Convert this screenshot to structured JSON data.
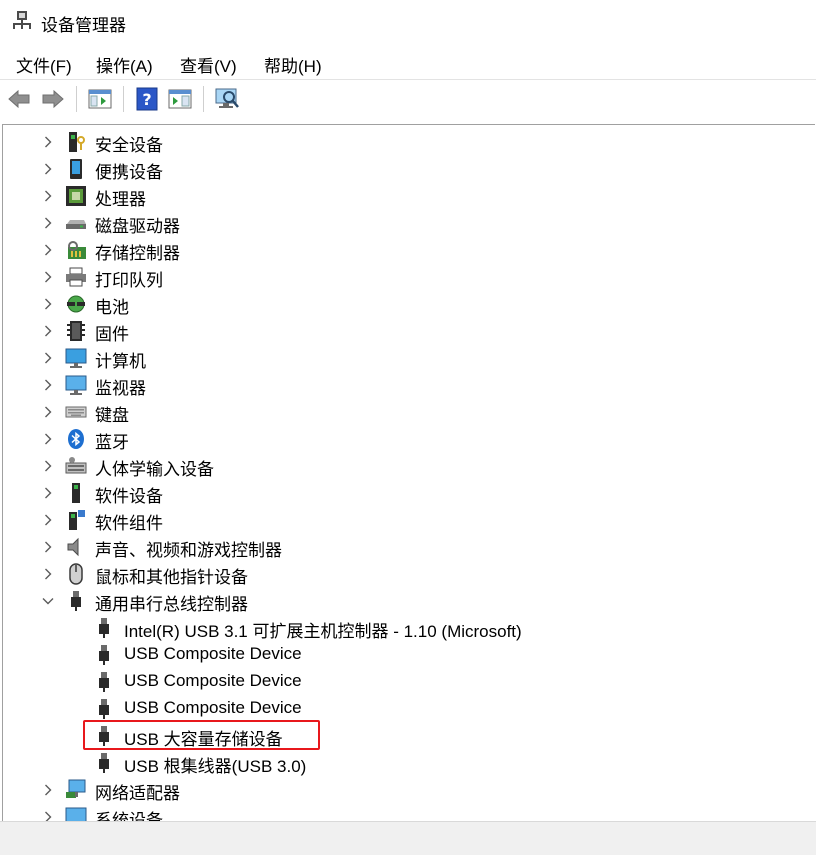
{
  "window": {
    "title": "设备管理器"
  },
  "menu": [
    {
      "label": "文件(F)"
    },
    {
      "label": "操作(A)"
    },
    {
      "label": "查看(V)"
    },
    {
      "label": "帮助(H)"
    }
  ],
  "toolbar": {
    "buttons": [
      {
        "name": "back-arrow-icon"
      },
      {
        "name": "forward-arrow-icon"
      },
      {
        "name": "show-hide-console-tree-icon"
      },
      {
        "name": "help-icon"
      },
      {
        "name": "show-action-pane-icon"
      },
      {
        "name": "scan-hardware-changes-icon"
      }
    ]
  },
  "tree": {
    "categories": [
      {
        "label": "安全设备",
        "icon": "security-device-icon",
        "expanded": false
      },
      {
        "label": "便携设备",
        "icon": "portable-device-icon",
        "expanded": false
      },
      {
        "label": "处理器",
        "icon": "processor-icon",
        "expanded": false
      },
      {
        "label": "磁盘驱动器",
        "icon": "disk-drive-icon",
        "expanded": false
      },
      {
        "label": "存储控制器",
        "icon": "storage-controller-icon",
        "expanded": false
      },
      {
        "label": "打印队列",
        "icon": "printer-icon",
        "expanded": false
      },
      {
        "label": "电池",
        "icon": "battery-icon",
        "expanded": false
      },
      {
        "label": "固件",
        "icon": "firmware-icon",
        "expanded": false
      },
      {
        "label": "计算机",
        "icon": "computer-icon",
        "expanded": false
      },
      {
        "label": "监视器",
        "icon": "monitor-icon",
        "expanded": false
      },
      {
        "label": "键盘",
        "icon": "keyboard-icon",
        "expanded": false
      },
      {
        "label": "蓝牙",
        "icon": "bluetooth-icon",
        "expanded": false
      },
      {
        "label": "人体学输入设备",
        "icon": "hid-icon",
        "expanded": false
      },
      {
        "label": "软件设备",
        "icon": "software-device-icon",
        "expanded": false
      },
      {
        "label": "软件组件",
        "icon": "software-component-icon",
        "expanded": false
      },
      {
        "label": "声音、视频和游戏控制器",
        "icon": "speaker-icon",
        "expanded": false
      },
      {
        "label": "鼠标和其他指针设备",
        "icon": "mouse-icon",
        "expanded": false
      },
      {
        "label": "通用串行总线控制器",
        "icon": "usb-controller-icon",
        "expanded": true,
        "children": [
          {
            "label": "Intel(R) USB 3.1 可扩展主机控制器 - 1.10 (Microsoft)",
            "icon": "usb-plug-icon"
          },
          {
            "label": "USB Composite Device",
            "icon": "usb-plug-icon"
          },
          {
            "label": "USB Composite Device",
            "icon": "usb-plug-icon"
          },
          {
            "label": "USB Composite Device",
            "icon": "usb-plug-icon"
          },
          {
            "label": "USB 大容量存储设备",
            "icon": "usb-plug-icon",
            "highlighted": true
          },
          {
            "label": "USB 根集线器(USB 3.0)",
            "icon": "usb-plug-icon"
          }
        ]
      },
      {
        "label": "网络适配器",
        "icon": "network-adapter-icon",
        "expanded": false
      },
      {
        "label": "系统设备",
        "icon": "system-device-icon",
        "expanded": false
      }
    ]
  },
  "colors": {
    "highlight_border": "#e8181c",
    "accent": "#2b78d6"
  }
}
